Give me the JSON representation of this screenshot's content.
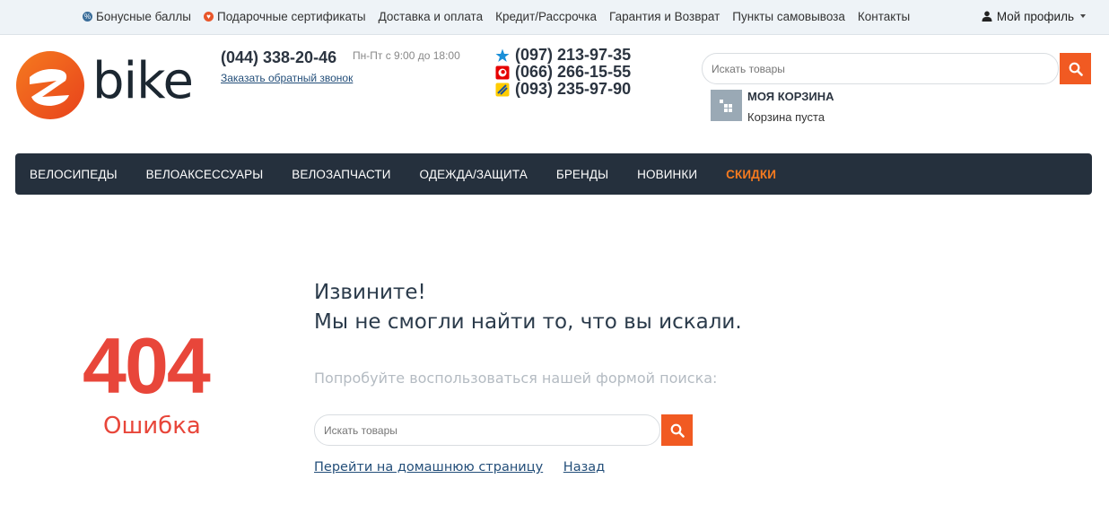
{
  "topbar": {
    "links": [
      {
        "label": "Бонусные баллы",
        "icon": "bonus-icon",
        "color": "#3a6d9a"
      },
      {
        "label": "Подарочные сертификаты",
        "icon": "gift-icon",
        "color": "#e8562a"
      },
      {
        "label": "Доставка и оплата"
      },
      {
        "label": "Кредит/Рассрочка"
      },
      {
        "label": "Гарантия и Возврат"
      },
      {
        "label": "Пункты самовывоза"
      },
      {
        "label": "Контакты"
      }
    ],
    "profile_label": "Мой профиль"
  },
  "logo": {
    "text": "bike",
    "brand_color": "#f15a22"
  },
  "contacts": {
    "main_phone": "(044) 338-20-46",
    "hours": "Пн-Пт с 9:00 до 18:00",
    "callback_label": "Заказать обратный звонок",
    "mobile_phones": [
      {
        "number": "(097) 213-97-35",
        "operator_icon": "kyivstar-icon"
      },
      {
        "number": "(066) 266-15-55",
        "operator_icon": "vodafone-icon"
      },
      {
        "number": "(093) 235-97-90",
        "operator_icon": "lifecell-icon"
      }
    ]
  },
  "search": {
    "placeholder": "Искать товары"
  },
  "cart": {
    "title": "МОЯ КОРЗИНА",
    "status": "Корзина пуста"
  },
  "nav": {
    "items": [
      "ВЕЛОСИПЕДЫ",
      "ВЕЛОАКСЕССУАРЫ",
      "ВЕЛОЗАПЧАСТИ",
      "ОДЕЖДА/ЗАЩИТА",
      "БРЕНДЫ",
      "НОВИНКИ"
    ],
    "sale_label": "СКИДКИ",
    "sale_color": "#f57a1f"
  },
  "error": {
    "code": "404",
    "label": "Ошибка",
    "line1": "Извините!",
    "line2": "Мы не смогли найти то, что вы искали.",
    "hint": "Попробуйте воспользоваться нашей формой поиска:",
    "search_placeholder": "Искать товары",
    "home_link": "Перейти на домашнюю страницу",
    "back_link": "Назад",
    "color": "#e8463a"
  }
}
